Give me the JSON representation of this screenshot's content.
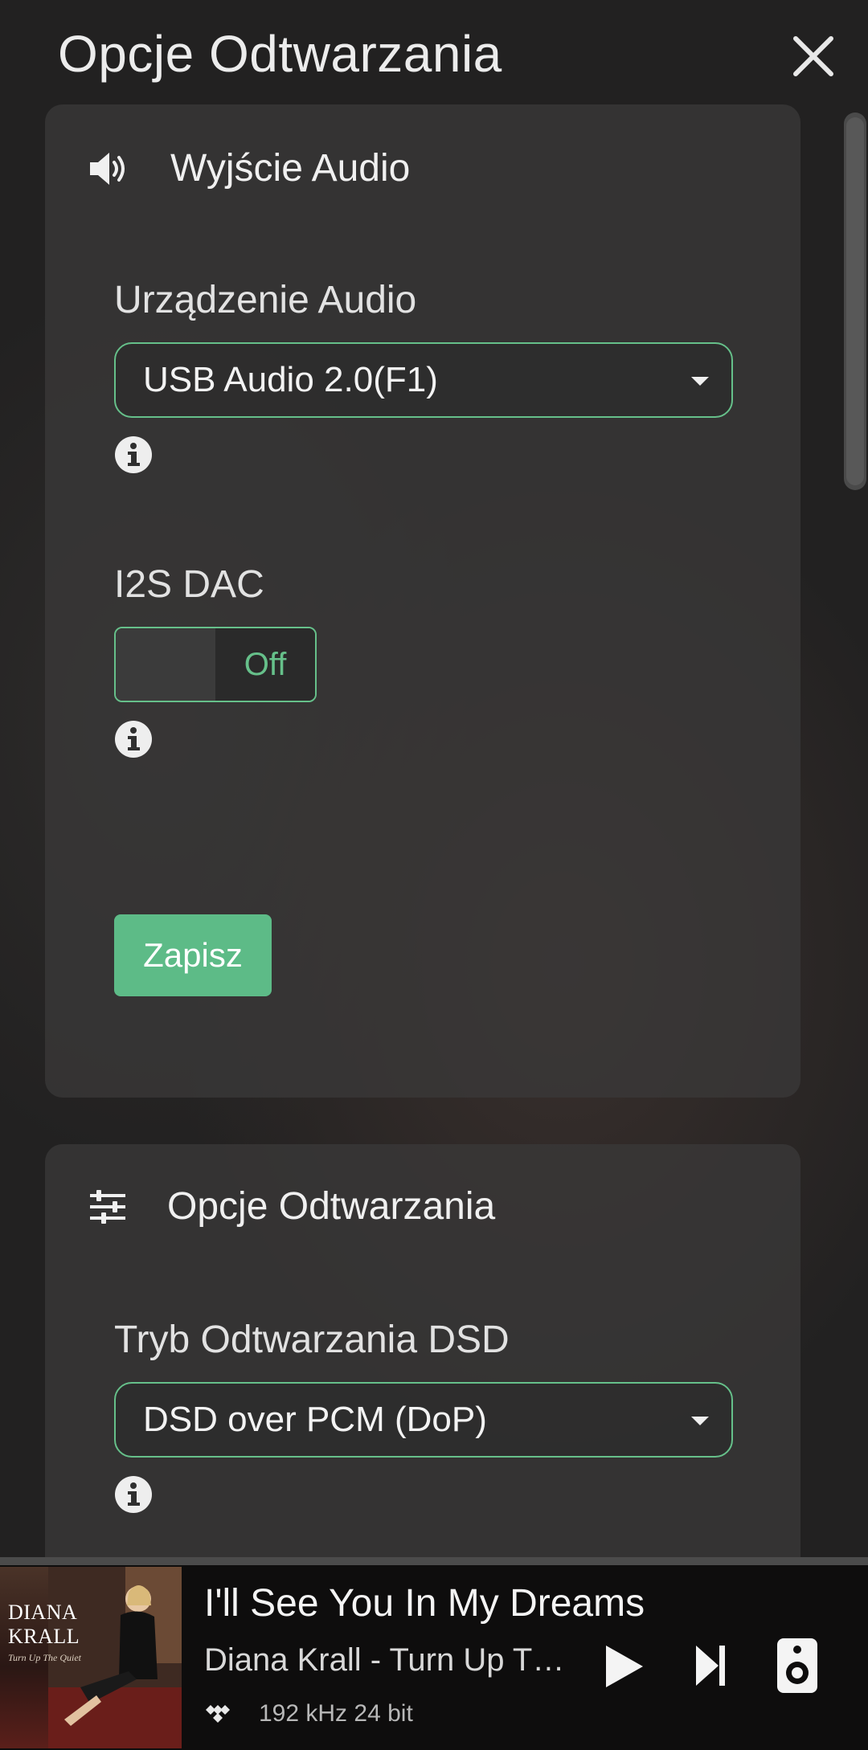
{
  "header": {
    "title": "Opcje Odtwarzania"
  },
  "audio_output": {
    "title": "Wyjście Audio",
    "device_label": "Urządzenie Audio",
    "device_value": "USB Audio 2.0(F1)",
    "i2s_label": "I2S DAC",
    "i2s_state": "Off",
    "save_label": "Zapisz"
  },
  "playback_options": {
    "title": "Opcje Odtwarzania",
    "dsd_label": "Tryb Odtwarzania DSD",
    "dsd_value": "DSD over PCM (DoP)"
  },
  "player": {
    "album_art_text": "DIANA KRALL",
    "album_art_subtext": "Turn Up The Quiet",
    "title": "I'll See You In My Dreams",
    "artist": "Diana Krall - Turn Up The ...",
    "quality": "192 kHz 24 bit"
  },
  "colors": {
    "accent": "#66c08a",
    "save_button": "#5dbb87",
    "background": "#222121",
    "card": "#393838"
  }
}
